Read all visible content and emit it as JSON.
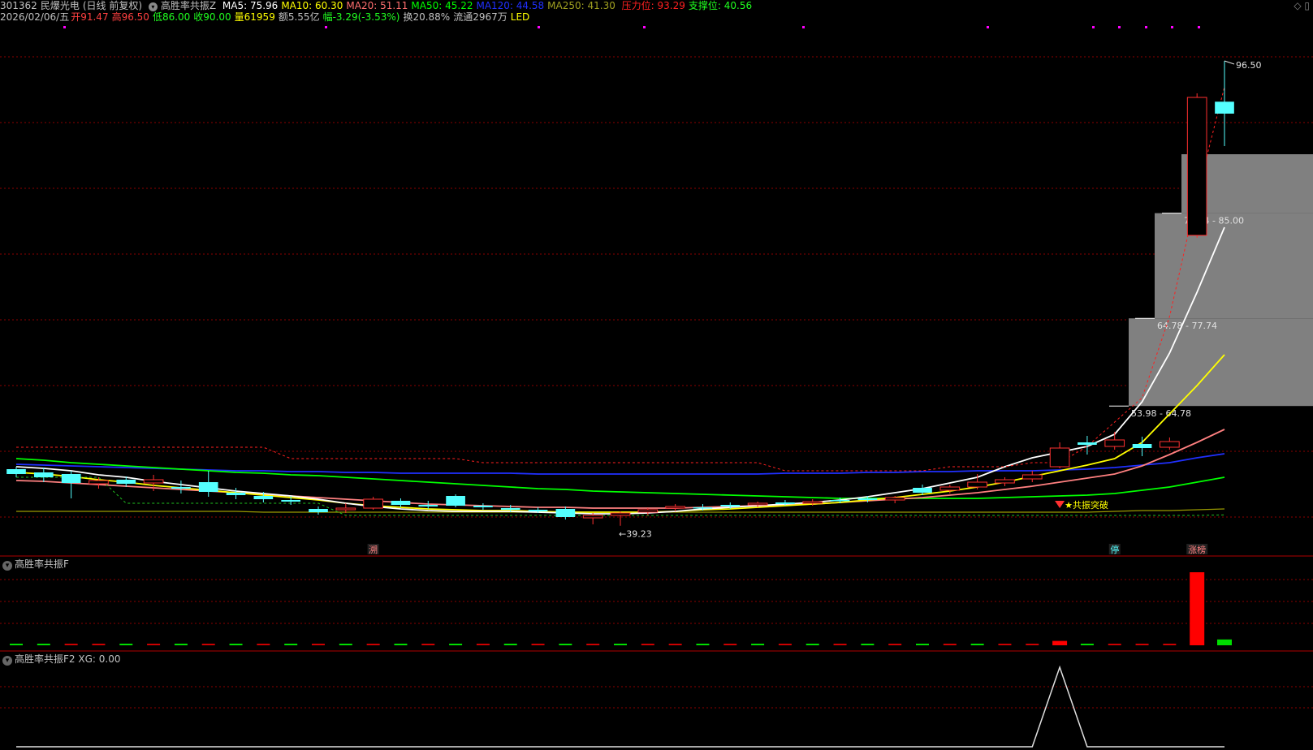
{
  "header": {
    "code": "301362",
    "name": "民爆光电",
    "period": "(日线 前复权)",
    "indicator": "高胜率共振Z",
    "ma": [
      {
        "label": "MA5: 75.96",
        "color": "#ffffff"
      },
      {
        "label": "MA10: 60.30",
        "color": "#ffff00"
      },
      {
        "label": "MA20: 51.11",
        "color": "#ff6f6f"
      },
      {
        "label": "MA50: 45.22",
        "color": "#00ff00"
      },
      {
        "label": "MA120: 44.58",
        "color": "#0000ff"
      },
      {
        "label": "MA250: 41.30",
        "color": "#999900"
      }
    ],
    "resistance": "压力位: 93.29",
    "support": "支撑位: 40.56"
  },
  "info": {
    "date": "2026/02/06/五",
    "open": "开91.47",
    "high": "高96.50",
    "low": "低86.00",
    "close": "收90.00",
    "volume": "量61959",
    "amount": "额5.55亿",
    "change": "幅-3.29(-3.53%)",
    "turnover": "换20.88%",
    "float": "流通2967万",
    "concept": "LED"
  },
  "chart_data": {
    "type": "candlestick",
    "price_range": [
      36,
      100
    ],
    "high_marker": "96.50",
    "low_marker": "39.23",
    "zones": [
      {
        "label": "53.98 - 64.78",
        "low": 53.98,
        "high": 64.78
      },
      {
        "label": "64.78 - 77.74",
        "low": 64.78,
        "high": 77.74
      },
      {
        "label": "77.74 - 85.00",
        "low": 77.74,
        "high": 85.0
      }
    ],
    "signal_label": "★共振突破",
    "markers": [
      "溯",
      "停",
      "涨榜"
    ],
    "ma5": [
      46.5,
      46.3,
      46.0,
      45.5,
      45.2,
      44.7,
      44.3,
      43.9,
      43.5,
      43.2,
      42.9,
      42.5,
      42.0,
      41.6,
      41.3,
      41.1,
      41.0,
      41.0,
      41.0,
      40.9,
      40.8,
      40.7,
      40.7,
      40.8,
      41.0,
      41.3,
      41.5,
      41.7,
      41.9,
      42.1,
      42.4,
      42.8,
      43.3,
      43.8,
      44.5,
      45.2,
      46.5,
      47.6,
      48.3,
      49.0,
      50.5,
      54.5,
      60.5,
      68.0,
      76.0
    ],
    "ma10": [
      45.8,
      45.6,
      45.3,
      44.9,
      44.6,
      44.2,
      43.9,
      43.6,
      43.3,
      43.0,
      42.7,
      42.4,
      42.0,
      41.7,
      41.5,
      41.3,
      41.2,
      41.1,
      41.1,
      41.0,
      40.9,
      40.9,
      40.9,
      40.9,
      41.0,
      41.2,
      41.3,
      41.5,
      41.7,
      41.9,
      42.1,
      42.4,
      42.7,
      43.1,
      43.5,
      44.0,
      44.6,
      45.3,
      46.0,
      46.7,
      47.5,
      49.5,
      53.0,
      56.5,
      60.3
    ],
    "ma20": [
      44.8,
      44.7,
      44.5,
      44.3,
      44.1,
      43.9,
      43.7,
      43.5,
      43.3,
      43.1,
      42.9,
      42.7,
      42.5,
      42.3,
      42.1,
      41.9,
      41.8,
      41.7,
      41.6,
      41.5,
      41.5,
      41.4,
      41.4,
      41.4,
      41.4,
      41.5,
      41.6,
      41.7,
      41.8,
      41.9,
      42.1,
      42.3,
      42.5,
      42.7,
      43.0,
      43.3,
      43.7,
      44.1,
      44.6,
      45.1,
      45.6,
      46.6,
      48.0,
      49.5,
      51.1
    ],
    "ma50": [
      47.5,
      47.3,
      47.0,
      46.8,
      46.6,
      46.4,
      46.2,
      46.0,
      45.8,
      45.7,
      45.5,
      45.4,
      45.2,
      45.0,
      44.8,
      44.6,
      44.4,
      44.2,
      44.0,
      43.8,
      43.7,
      43.5,
      43.4,
      43.3,
      43.2,
      43.1,
      43.0,
      42.9,
      42.8,
      42.7,
      42.6,
      42.6,
      42.6,
      42.6,
      42.6,
      42.6,
      42.7,
      42.8,
      42.9,
      43.0,
      43.2,
      43.6,
      44.0,
      44.6,
      45.2
    ],
    "ma120": [
      46.8,
      46.7,
      46.6,
      46.5,
      46.4,
      46.3,
      46.2,
      46.1,
      46.0,
      46.0,
      45.9,
      45.9,
      45.8,
      45.8,
      45.7,
      45.7,
      45.7,
      45.7,
      45.7,
      45.6,
      45.6,
      45.6,
      45.6,
      45.6,
      45.6,
      45.6,
      45.6,
      45.6,
      45.7,
      45.7,
      45.7,
      45.8,
      45.8,
      45.9,
      45.9,
      46.0,
      46.0,
      46.0,
      46.1,
      46.2,
      46.4,
      46.7,
      47.0,
      47.6,
      48.1
    ],
    "ma250": [
      41.0,
      41.0,
      41.0,
      41.0,
      41.0,
      41.0,
      41.0,
      41.0,
      41.0,
      40.9,
      40.9,
      40.9,
      40.9,
      40.9,
      40.9,
      40.9,
      40.9,
      40.9,
      40.9,
      40.9,
      40.9,
      40.9,
      40.9,
      40.9,
      40.9,
      40.9,
      40.9,
      40.9,
      40.9,
      40.9,
      40.9,
      40.9,
      40.9,
      40.9,
      40.9,
      40.9,
      40.9,
      40.9,
      40.9,
      40.9,
      41.0,
      41.1,
      41.1,
      41.2,
      41.3
    ],
    "resistance_line": [
      48.9,
      48.9,
      48.9,
      48.9,
      48.9,
      48.9,
      48.9,
      48.9,
      48.9,
      48.9,
      47.5,
      47.5,
      47.5,
      47.5,
      47.5,
      47.5,
      47.5,
      47.0,
      47.0,
      47.0,
      47.0,
      47.0,
      47.0,
      47.0,
      47.0,
      47.0,
      47.0,
      47.0,
      46.0,
      46.0,
      46.0,
      46.0,
      46.0,
      46.0,
      46.5,
      46.5,
      46.5,
      47.0,
      47.0,
      49.0,
      52.0,
      55.0,
      65.0,
      80.0,
      93.3
    ],
    "support_line": [
      45.2,
      45.2,
      45.2,
      45.2,
      42.0,
      42.0,
      42.0,
      42.0,
      42.0,
      42.0,
      42.0,
      42.0,
      40.5,
      40.5,
      40.5,
      40.5,
      40.5,
      40.5,
      40.5,
      40.5,
      40.5,
      40.5,
      40.5,
      40.5,
      40.5,
      40.5,
      40.5,
      40.5,
      40.5,
      40.5,
      40.5,
      40.5,
      40.5,
      40.5,
      40.5,
      40.5,
      40.5,
      40.5,
      40.5,
      40.5,
      40.5,
      40.5,
      40.5,
      40.5,
      40.56
    ],
    "candles": [
      {
        "o": 46.2,
        "h": 46.5,
        "l": 45.2,
        "c": 45.6
      },
      {
        "o": 45.8,
        "h": 46.4,
        "l": 44.6,
        "c": 45.2
      },
      {
        "o": 45.6,
        "h": 46.0,
        "l": 42.6,
        "c": 44.5
      },
      {
        "o": 44.4,
        "h": 45.2,
        "l": 43.8,
        "c": 44.8
      },
      {
        "o": 44.9,
        "h": 45.3,
        "l": 44.0,
        "c": 44.4
      },
      {
        "o": 44.5,
        "h": 45.5,
        "l": 43.5,
        "c": 44.9
      },
      {
        "o": 44.0,
        "h": 44.8,
        "l": 43.2,
        "c": 43.8
      },
      {
        "o": 44.6,
        "h": 46.0,
        "l": 42.8,
        "c": 43.4
      },
      {
        "o": 43.3,
        "h": 43.9,
        "l": 42.5,
        "c": 43.0
      },
      {
        "o": 42.9,
        "h": 43.4,
        "l": 42.1,
        "c": 42.5
      },
      {
        "o": 42.4,
        "h": 42.9,
        "l": 41.8,
        "c": 42.2
      },
      {
        "o": 41.3,
        "h": 41.6,
        "l": 40.6,
        "c": 40.9
      },
      {
        "o": 41.2,
        "h": 42.0,
        "l": 40.8,
        "c": 41.4
      },
      {
        "o": 41.4,
        "h": 42.8,
        "l": 41.2,
        "c": 42.5
      },
      {
        "o": 42.3,
        "h": 42.6,
        "l": 41.5,
        "c": 41.8
      },
      {
        "o": 41.8,
        "h": 42.3,
        "l": 41.3,
        "c": 41.6
      },
      {
        "o": 42.9,
        "h": 43.1,
        "l": 41.5,
        "c": 41.7
      },
      {
        "o": 41.7,
        "h": 42.0,
        "l": 41.2,
        "c": 41.5
      },
      {
        "o": 41.4,
        "h": 41.8,
        "l": 40.9,
        "c": 41.2
      },
      {
        "o": 41.2,
        "h": 41.5,
        "l": 40.8,
        "c": 41.0
      },
      {
        "o": 41.3,
        "h": 41.6,
        "l": 40.0,
        "c": 40.3
      },
      {
        "o": 40.2,
        "h": 40.8,
        "l": 39.4,
        "c": 40.5
      },
      {
        "o": 40.5,
        "h": 41.0,
        "l": 39.23,
        "c": 40.8
      },
      {
        "o": 40.9,
        "h": 41.4,
        "l": 40.5,
        "c": 41.2
      },
      {
        "o": 41.4,
        "h": 41.9,
        "l": 41.0,
        "c": 41.6
      },
      {
        "o": 41.5,
        "h": 41.9,
        "l": 41.1,
        "c": 41.4
      },
      {
        "o": 41.8,
        "h": 42.1,
        "l": 41.3,
        "c": 41.6
      },
      {
        "o": 41.8,
        "h": 42.2,
        "l": 41.5,
        "c": 42.0
      },
      {
        "o": 42.1,
        "h": 42.4,
        "l": 41.7,
        "c": 41.9
      },
      {
        "o": 42.0,
        "h": 42.5,
        "l": 41.7,
        "c": 42.2
      },
      {
        "o": 42.4,
        "h": 42.7,
        "l": 42.0,
        "c": 42.3
      },
      {
        "o": 42.6,
        "h": 42.9,
        "l": 42.1,
        "c": 42.4
      },
      {
        "o": 42.4,
        "h": 42.9,
        "l": 42.0,
        "c": 42.7
      },
      {
        "o": 43.9,
        "h": 44.3,
        "l": 43.0,
        "c": 43.3
      },
      {
        "o": 43.6,
        "h": 44.3,
        "l": 43.2,
        "c": 44.0
      },
      {
        "o": 44.0,
        "h": 45.6,
        "l": 43.7,
        "c": 44.6
      },
      {
        "o": 44.5,
        "h": 45.2,
        "l": 44.1,
        "c": 44.9
      },
      {
        "o": 45.0,
        "h": 46.0,
        "l": 44.6,
        "c": 45.5
      },
      {
        "o": 46.5,
        "h": 49.5,
        "l": 46.3,
        "c": 48.8
      },
      {
        "o": 49.5,
        "h": 50.3,
        "l": 48.0,
        "c": 49.2
      },
      {
        "o": 49.0,
        "h": 50.8,
        "l": 48.6,
        "c": 49.8
      },
      {
        "o": 49.3,
        "h": 50.2,
        "l": 47.8,
        "c": 48.8
      },
      {
        "o": 48.9,
        "h": 50.1,
        "l": 48.6,
        "c": 49.6
      },
      {
        "o": 75.0,
        "h": 92.5,
        "l": 74.7,
        "c": 92.0
      },
      {
        "o": 91.47,
        "h": 96.5,
        "l": 86.0,
        "c": 90.0
      }
    ],
    "volume_f": [
      1,
      1,
      0,
      0,
      1,
      0,
      1,
      0,
      1,
      0,
      1,
      0,
      1,
      0,
      1,
      0,
      1,
      0,
      1,
      0,
      1,
      0,
      1,
      0,
      0,
      1,
      0,
      1,
      0,
      1,
      0,
      1,
      0,
      1,
      0,
      1,
      0,
      0,
      0,
      1,
      0,
      0,
      0,
      1,
      1
    ],
    "f_big": [
      {
        "i": 38,
        "v": 6
      },
      {
        "i": 43,
        "v": 100
      },
      {
        "i": 44,
        "v": 8
      }
    ],
    "f2_peak_index": 38
  },
  "panels": {
    "f": {
      "title": "高胜率共振F"
    },
    "f2": {
      "title": "高胜率共振F2",
      "xg": "XG: 0.00"
    }
  }
}
